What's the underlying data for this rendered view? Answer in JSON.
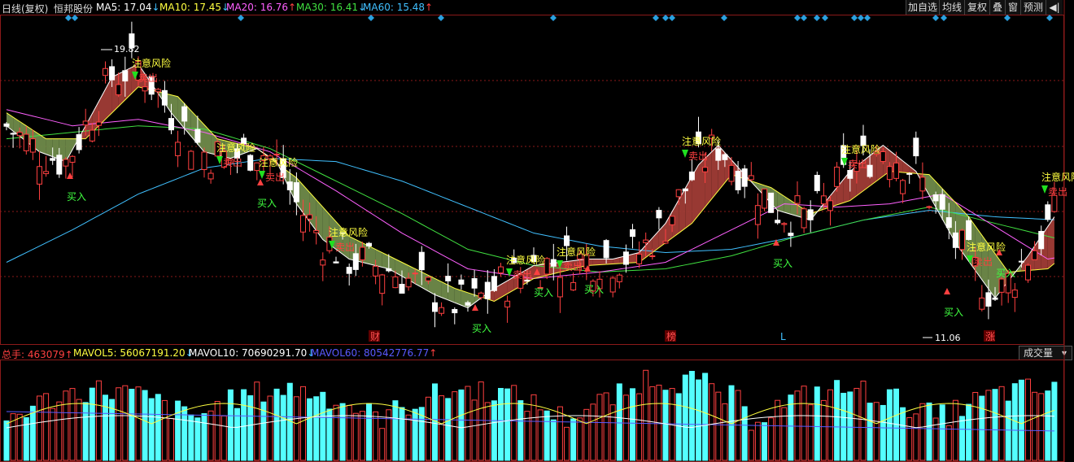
{
  "header": {
    "period": "日线(复权)",
    "stock_name": "恒邦股份",
    "indicators": [
      {
        "text": "MA5: 17.04",
        "arrow": "↓",
        "color": "#ffffff",
        "arrow_color": "#40c0ff"
      },
      {
        "text": "MA10: 17.45",
        "arrow": "↓",
        "color": "#ffff40",
        "arrow_color": "#40c0ff"
      },
      {
        "text": "MA20: 16.76",
        "arrow": "↑",
        "color": "#ff60ff",
        "arrow_color": "#ff4040"
      },
      {
        "text": "MA30: 16.41",
        "arrow": "↓",
        "color": "#40e040",
        "arrow_color": "#40c0ff"
      },
      {
        "text": "MA60: 15.48",
        "arrow": "↑",
        "color": "#40c0ff",
        "arrow_color": "#ff4040"
      }
    ]
  },
  "toolbar": {
    "add_watch": "加自选",
    "ma_line": "均线",
    "restore_rights": "复权",
    "overlay": "叠",
    "window": "窗",
    "forecast": "预测",
    "collapse": "◀|"
  },
  "price_chart": {
    "high_label": "19.82",
    "low_label": "11.06",
    "y_max": 19.82,
    "y_min": 11.06,
    "risk_label": "注意风险",
    "sell_label": "卖出",
    "buy_label": "买入",
    "event_markers": [
      {
        "text": "财",
        "kind": "box"
      },
      {
        "text": "榜",
        "kind": "box"
      },
      {
        "text": "L",
        "kind": "plain"
      },
      {
        "text": "涨",
        "kind": "box"
      }
    ]
  },
  "volume_header": {
    "total_hands": "总手: 463079",
    "total_arrow": "↑",
    "mavol5": "MAVOL5: 56067191.20",
    "mavol5_arrow": "↓",
    "mavol10": "MAVOL10: 70690291.70",
    "mavol10_arrow": "↓",
    "mavol60": "MAVOL60: 80542776.77",
    "mavol60_arrow": "↑",
    "selector": "成交量"
  },
  "colors": {
    "up": "#ff4040",
    "down": "#54ffff",
    "ma5": "#ffffff",
    "ma10": "#ffff40",
    "ma20": "#ff60ff",
    "ma30": "#40e040",
    "ma60": "#40c0ff",
    "band_up": "#a03c36",
    "band_down": "#6f8a4a",
    "grid": "#8b1a1a",
    "diamond": "#2aa0e0"
  }
}
